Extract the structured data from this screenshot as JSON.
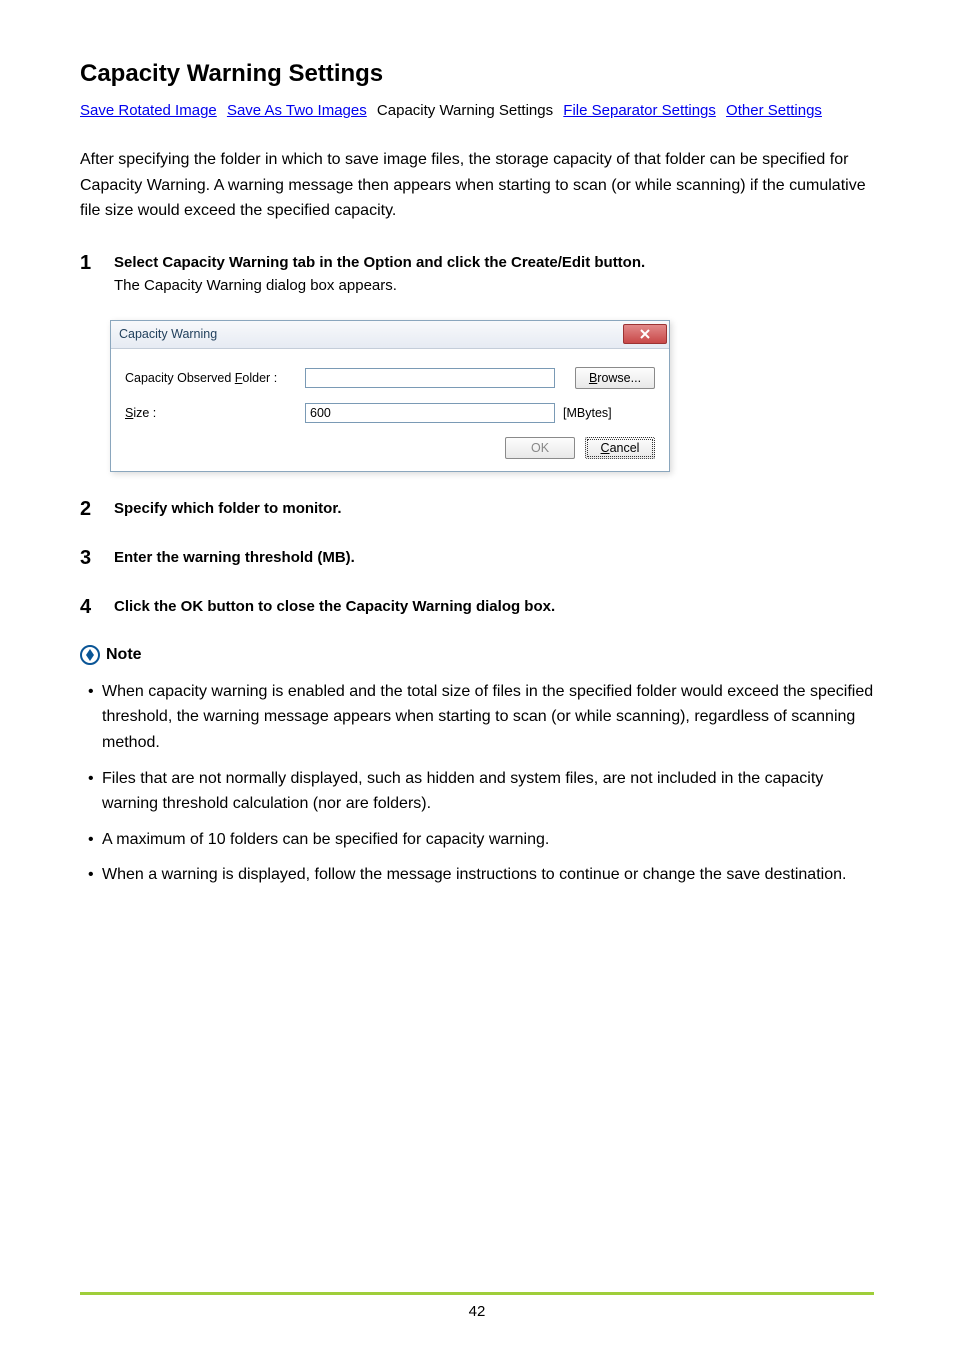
{
  "page": {
    "title": "Capacity Warning Settings",
    "intro": "After specifying the folder in which to save image files, the storage capacity of that folder can be specified for Capacity Warning. A warning message then appears when starting to scan (or while scanning) if the cumulative file size would exceed the specified capacity.",
    "page_number": "42"
  },
  "nav": {
    "link1": "Save Rotated Image",
    "link2": "Save As Two Images",
    "current": "Capacity Warning Settings",
    "link4": "File Separator Settings",
    "link5": "Other Settings"
  },
  "steps": {
    "s1": {
      "num": "1",
      "title": "Select Capacity Warning tab in the Option and click the Create/Edit button.",
      "sub": "The Capacity Warning dialog box appears."
    },
    "s2": {
      "num": "2",
      "title": "Specify which folder to monitor."
    },
    "s3": {
      "num": "3",
      "title": "Enter the warning threshold (MB)."
    },
    "s4": {
      "num": "4",
      "title": "Click the OK button to close the Capacity Warning dialog box."
    }
  },
  "dialog": {
    "title": "Capacity Warning",
    "label_folder_pre": "Capacity Observed ",
    "label_folder_u": "F",
    "label_folder_post": "older :",
    "label_size_u": "S",
    "label_size_post": "ize :",
    "folder_value": "",
    "size_value": "600",
    "units": "[MBytes]",
    "browse_u": "B",
    "browse_post": "rowse...",
    "ok": "OK",
    "cancel_u": "C",
    "cancel_post": "ancel"
  },
  "note": {
    "heading": "Note",
    "items": [
      "When capacity warning is enabled and the total size of files in the specified folder would exceed the specified threshold, the warning message appears when starting to scan (or while scanning), regardless of scanning method.",
      "Files that are not normally displayed, such as hidden and system files, are not included in the capacity warning threshold calculation (nor are folders).",
      "A maximum of 10 folders can be specified for capacity warning.",
      "When a warning is displayed, follow the message instructions to continue or change the save destination."
    ]
  }
}
